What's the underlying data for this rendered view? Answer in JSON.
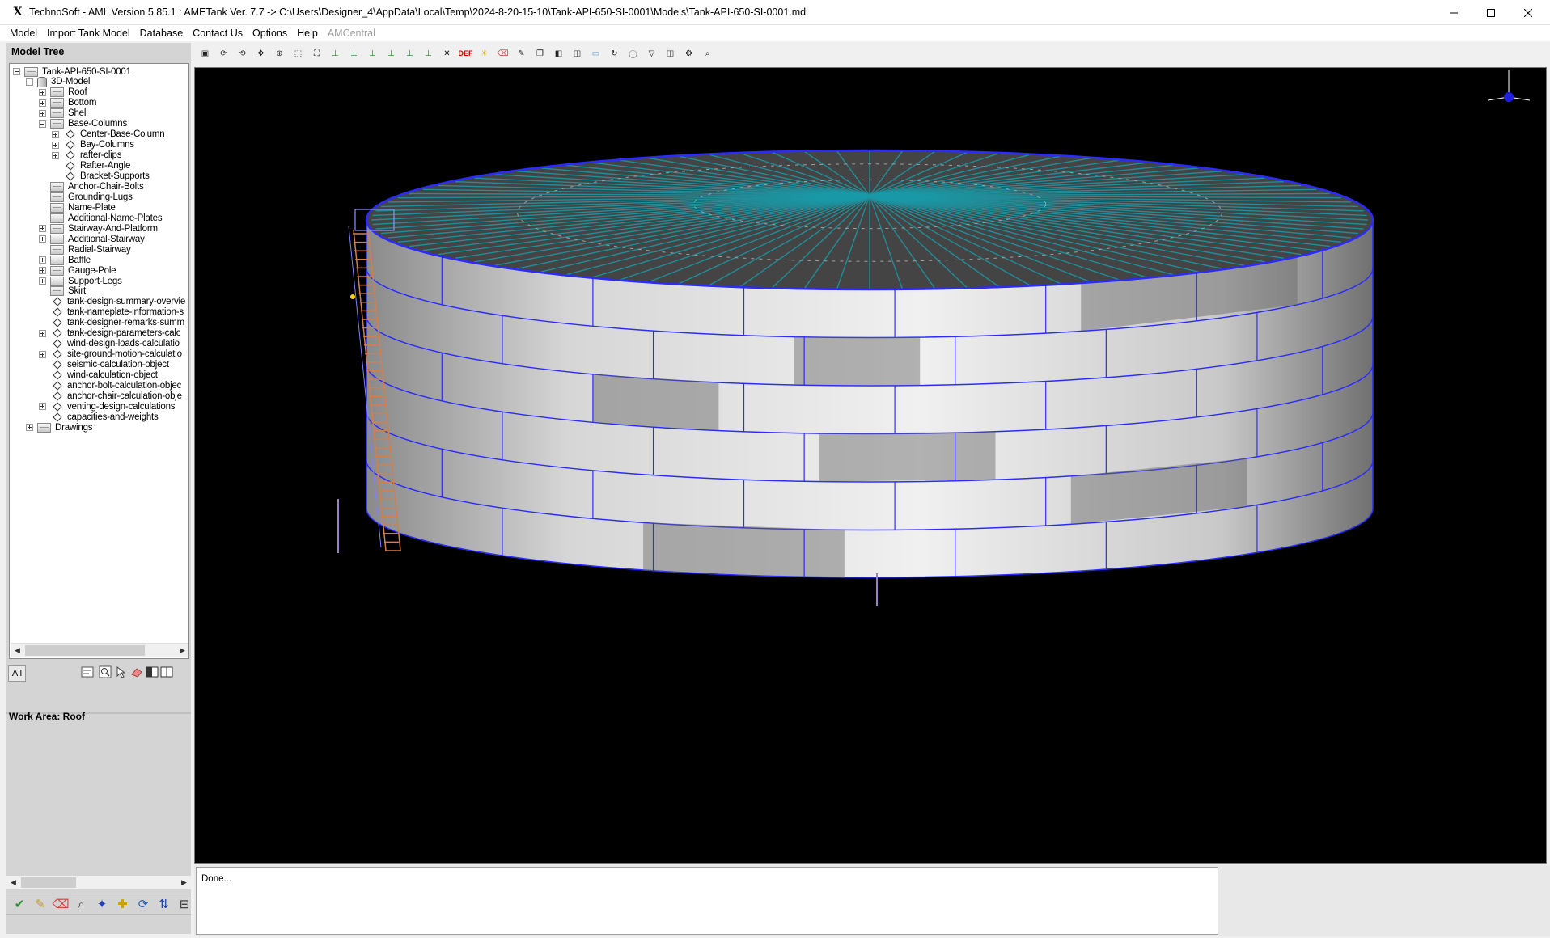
{
  "window": {
    "title": "TechnoSoft - AML Version 5.85.1 : AMETank Ver. 7.7 -> C:\\Users\\Designer_4\\AppData\\Local\\Temp\\2024-8-20-15-10\\Tank-API-650-SI-0001\\Models\\Tank-API-650-SI-0001.mdl",
    "logo": "X"
  },
  "menu": [
    {
      "label": "Model",
      "enabled": true
    },
    {
      "label": "Import Tank Model",
      "enabled": true
    },
    {
      "label": "Database",
      "enabled": true
    },
    {
      "label": "Contact Us",
      "enabled": true
    },
    {
      "label": "Options",
      "enabled": true
    },
    {
      "label": "Help",
      "enabled": true
    },
    {
      "label": "AMCentral",
      "enabled": false
    }
  ],
  "model_tree": {
    "header": "Model Tree",
    "items": [
      {
        "label": "Tank-API-650-SI-0001",
        "level": 0,
        "expander": "minus",
        "icon": "folder-box-icon"
      },
      {
        "label": "3D-Model",
        "level": 1,
        "expander": "minus",
        "icon": "model-icon"
      },
      {
        "label": "Roof",
        "level": 2,
        "expander": "plus",
        "icon": "folder-box-icon"
      },
      {
        "label": "Bottom",
        "level": 2,
        "expander": "plus",
        "icon": "folder-box-icon"
      },
      {
        "label": "Shell",
        "level": 2,
        "expander": "plus",
        "icon": "folder-box-icon"
      },
      {
        "label": "Base-Columns",
        "level": 2,
        "expander": "minus",
        "icon": "folder-box-icon"
      },
      {
        "label": "Center-Base-Column",
        "level": 3,
        "expander": "plus",
        "icon": "diamond-icon"
      },
      {
        "label": "Bay-Columns",
        "level": 3,
        "expander": "plus",
        "icon": "diamond-icon"
      },
      {
        "label": "rafter-clips",
        "level": 3,
        "expander": "plus",
        "icon": "diamond-icon"
      },
      {
        "label": "Rafter-Angle",
        "level": 3,
        "expander": "none",
        "icon": "diamond-icon"
      },
      {
        "label": "Bracket-Supports",
        "level": 3,
        "expander": "none",
        "icon": "diamond-icon"
      },
      {
        "label": "Anchor-Chair-Bolts",
        "level": 2,
        "expander": "none",
        "icon": "folder-box-icon"
      },
      {
        "label": "Grounding-Lugs",
        "level": 2,
        "expander": "none",
        "icon": "folder-box-icon"
      },
      {
        "label": "Name-Plate",
        "level": 2,
        "expander": "none",
        "icon": "folder-box-icon"
      },
      {
        "label": "Additional-Name-Plates",
        "level": 2,
        "expander": "none",
        "icon": "folder-box-icon"
      },
      {
        "label": "Stairway-And-Platform",
        "level": 2,
        "expander": "plus",
        "icon": "folder-box-icon"
      },
      {
        "label": "Additional-Stairway",
        "level": 2,
        "expander": "plus",
        "icon": "folder-box-icon"
      },
      {
        "label": "Radial-Stairway",
        "level": 2,
        "expander": "none",
        "icon": "folder-box-icon"
      },
      {
        "label": "Baffle",
        "level": 2,
        "expander": "plus",
        "icon": "folder-box-icon"
      },
      {
        "label": "Gauge-Pole",
        "level": 2,
        "expander": "plus",
        "icon": "folder-box-icon"
      },
      {
        "label": "Support-Legs",
        "level": 2,
        "expander": "plus",
        "icon": "folder-box-icon"
      },
      {
        "label": "Skirt",
        "level": 2,
        "expander": "none",
        "icon": "folder-box-icon"
      },
      {
        "label": "tank-design-summary-overvie",
        "level": 2,
        "expander": "none",
        "icon": "diamond-icon"
      },
      {
        "label": "tank-nameplate-information-s",
        "level": 2,
        "expander": "none",
        "icon": "diamond-icon"
      },
      {
        "label": "tank-designer-remarks-summ",
        "level": 2,
        "expander": "none",
        "icon": "diamond-icon"
      },
      {
        "label": "tank-design-parameters-calc",
        "level": 2,
        "expander": "plus",
        "icon": "diamond-icon"
      },
      {
        "label": "wind-design-loads-calculatio",
        "level": 2,
        "expander": "none",
        "icon": "diamond-icon"
      },
      {
        "label": "site-ground-motion-calculatio",
        "level": 2,
        "expander": "plus",
        "icon": "diamond-icon"
      },
      {
        "label": "seismic-calculation-object",
        "level": 2,
        "expander": "none",
        "icon": "diamond-icon"
      },
      {
        "label": "wind-calculation-object",
        "level": 2,
        "expander": "none",
        "icon": "diamond-icon"
      },
      {
        "label": "anchor-bolt-calculation-objec",
        "level": 2,
        "expander": "none",
        "icon": "diamond-icon"
      },
      {
        "label": "anchor-chair-calculation-obje",
        "level": 2,
        "expander": "none",
        "icon": "diamond-icon"
      },
      {
        "label": "venting-design-calculations",
        "level": 2,
        "expander": "plus",
        "icon": "diamond-icon"
      },
      {
        "label": "capacities-and-weights",
        "level": 2,
        "expander": "none",
        "icon": "diamond-icon"
      },
      {
        "label": "Drawings",
        "level": 1,
        "expander": "plus",
        "icon": "folder-box-icon"
      }
    ]
  },
  "tree_tools": {
    "all_label": "All",
    "icons": [
      "tree-view-icon",
      "zoom-fit-icon",
      "select-icon",
      "eraser-icon",
      "split-view-icon",
      "split-view-alt-icon"
    ]
  },
  "work_area": {
    "label": "Work Area: Roof"
  },
  "bottom_tools": [
    "check-icon",
    "pencil-icon",
    "eraser-icon",
    "zoom-icon",
    "compass-icon",
    "add-icon",
    "refresh-icon",
    "swap-updown-icon",
    "collapse-icon"
  ],
  "toolbar": [
    "view-front-icon",
    "rotate-icon",
    "rotate-alt-icon",
    "pan-icon",
    "zoom-in-icon",
    "zoom-box-icon",
    "zoom-fit-icon",
    "view-yx-icon",
    "view-xy-icon",
    "view-zx-icon",
    "view-xz-icon",
    "view-yz-icon",
    "view-zy-icon",
    "axes-icon",
    "default-view-icon",
    "light-icon",
    "eraser-icon",
    "paint-icon",
    "copy-icon",
    "split-icon",
    "split-alt-icon",
    "window-icon",
    "refresh-icon",
    "info-icon",
    "filter-icon",
    "layers-icon",
    "settings-icon",
    "search-icon"
  ],
  "toolbar_labels": {
    "def": "DEF"
  },
  "status": {
    "message": "Done..."
  },
  "colors": {
    "viewport_bg": "#000000",
    "shell_light": "#e6e6e6",
    "shell_dark": "#9a9a9a",
    "weld_lines": "#2b2bff",
    "roof": "#444444",
    "rafters": "#1a9aa8",
    "stairway": "#d08050"
  }
}
